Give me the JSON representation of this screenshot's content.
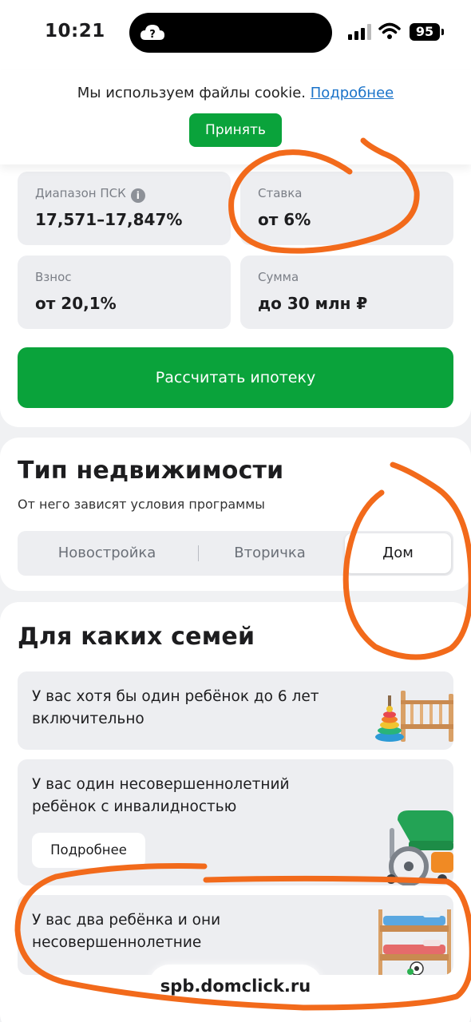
{
  "status_bar": {
    "time": "10:21",
    "battery": "95"
  },
  "cookie": {
    "text": "Мы используем файлы cookie.",
    "link": "Подробнее",
    "accept": "Принять"
  },
  "params": [
    {
      "label": "Диапазон ПСК",
      "value": "17,571–17,847%",
      "info": "i"
    },
    {
      "label": "Ставка",
      "value": "от 6%"
    },
    {
      "label": "Взнос",
      "value": "от 20,1%"
    },
    {
      "label": "Сумма",
      "value": "до 30 млн ₽"
    }
  ],
  "calc_button": "Рассчитать ипотеку",
  "property": {
    "title": "Тип недвижимости",
    "subtitle": "От него зависят условия программы",
    "options": [
      "Новостройка",
      "Вторичка",
      "Дом"
    ],
    "selected": "Дом"
  },
  "families": {
    "title": "Для каких семей",
    "items": [
      {
        "line1": "У вас хотя бы один ребёнок до 6 лет",
        "line2": "включительно"
      },
      {
        "line1": "У вас один несовершеннолетний",
        "line2": "ребёнок с инвалидностью",
        "button": "Подробнее"
      },
      {
        "line1": "У вас два ребёнка и они",
        "line2": "несовершеннолетние"
      }
    ]
  },
  "url": "spb.domclick.ru",
  "colors": {
    "accent_green": "#0aa33b",
    "link_blue": "#1a73c9",
    "scribble_orange": "#f26a1b"
  }
}
